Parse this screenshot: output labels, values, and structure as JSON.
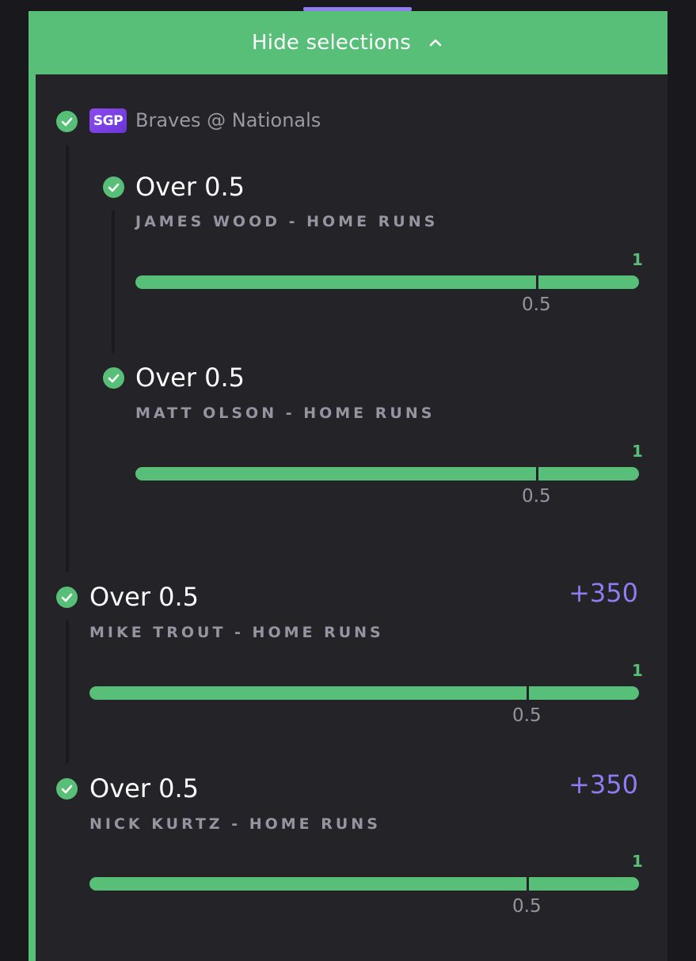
{
  "header": {
    "label": "Hide selections",
    "icon": "chevron-up-icon"
  },
  "colors": {
    "accent_green": "#57bf77",
    "accent_purple": "#8d7df1",
    "background": "#242328"
  },
  "parlay": {
    "badge": "SGP",
    "game": "Braves @ Nationals",
    "legs": [
      {
        "title": "Over 0.5",
        "subtitle": "JAMES WOOD - HOME RUNS",
        "actual": "1",
        "line": "0.5",
        "progress": 1.0
      },
      {
        "title": "Over 0.5",
        "subtitle": "MATT OLSON - HOME RUNS",
        "actual": "1",
        "line": "0.5",
        "progress": 1.0
      }
    ]
  },
  "picks": [
    {
      "title": "Over 0.5",
      "odds": "+350",
      "subtitle": "MIKE TROUT - HOME RUNS",
      "actual": "1",
      "line": "0.5",
      "progress": 1.0
    },
    {
      "title": "Over 0.5",
      "odds": "+350",
      "subtitle": "NICK KURTZ - HOME RUNS",
      "actual": "1",
      "line": "0.5",
      "progress": 1.0
    }
  ]
}
